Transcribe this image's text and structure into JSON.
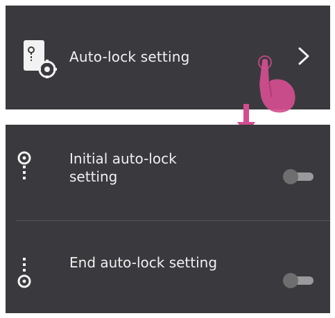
{
  "header": {
    "label": "Auto-lock setting",
    "icon": "door-settings-icon",
    "chevron": ">"
  },
  "settings": {
    "items": [
      {
        "label": "Initial auto-lock setting",
        "icon": "lock-start-icon",
        "enabled": false
      },
      {
        "label": "End auto-lock setting",
        "icon": "lock-end-icon",
        "enabled": false
      }
    ]
  },
  "colors": {
    "panel": "#3a3a3e",
    "text": "#f0f0f0",
    "accent": "#d44e8f"
  }
}
